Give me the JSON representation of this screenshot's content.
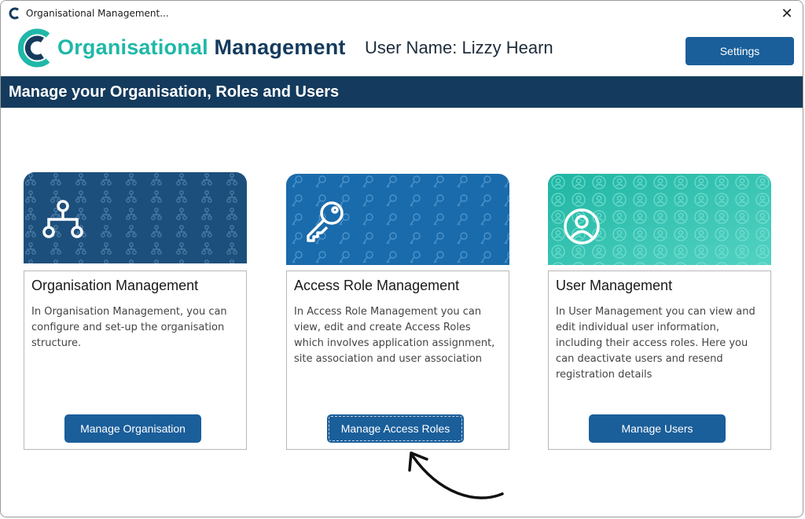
{
  "window": {
    "title": "Organisational Management...",
    "close_glyph": "✕"
  },
  "header": {
    "brand_part1": "Organisational",
    "brand_part2": "Management",
    "user_name": "User Name: Lizzy Hearn",
    "settings_label": "Settings"
  },
  "banner": {
    "title": "Manage your Organisation, Roles and Users"
  },
  "cards": [
    {
      "title": "Organisation Management",
      "description": "In Organisation Management, you can configure and set-up the organisation structure.",
      "button": "Manage Organisation",
      "icon": "hierarchy-icon"
    },
    {
      "title": "Access Role Management",
      "description": "In Access Role Management you can view, edit and create Access Roles which involves application assignment, site association and user association",
      "button": "Manage Access Roles",
      "icon": "key-icon"
    },
    {
      "title": "User Management",
      "description": "In User Management you can view and edit  individual user information, including their access roles. Here you can deactivate users and resend registration details",
      "button": "Manage Users",
      "icon": "user-circle-icon"
    }
  ],
  "colors": {
    "brand_teal": "#1fb8a8",
    "brand_navy": "#143b5d",
    "button_blue": "#1a5e9a",
    "card1_bg": "#1d4f7c",
    "card2_bg": "#1a6bab",
    "card3_bg": "#2cc0ae"
  }
}
